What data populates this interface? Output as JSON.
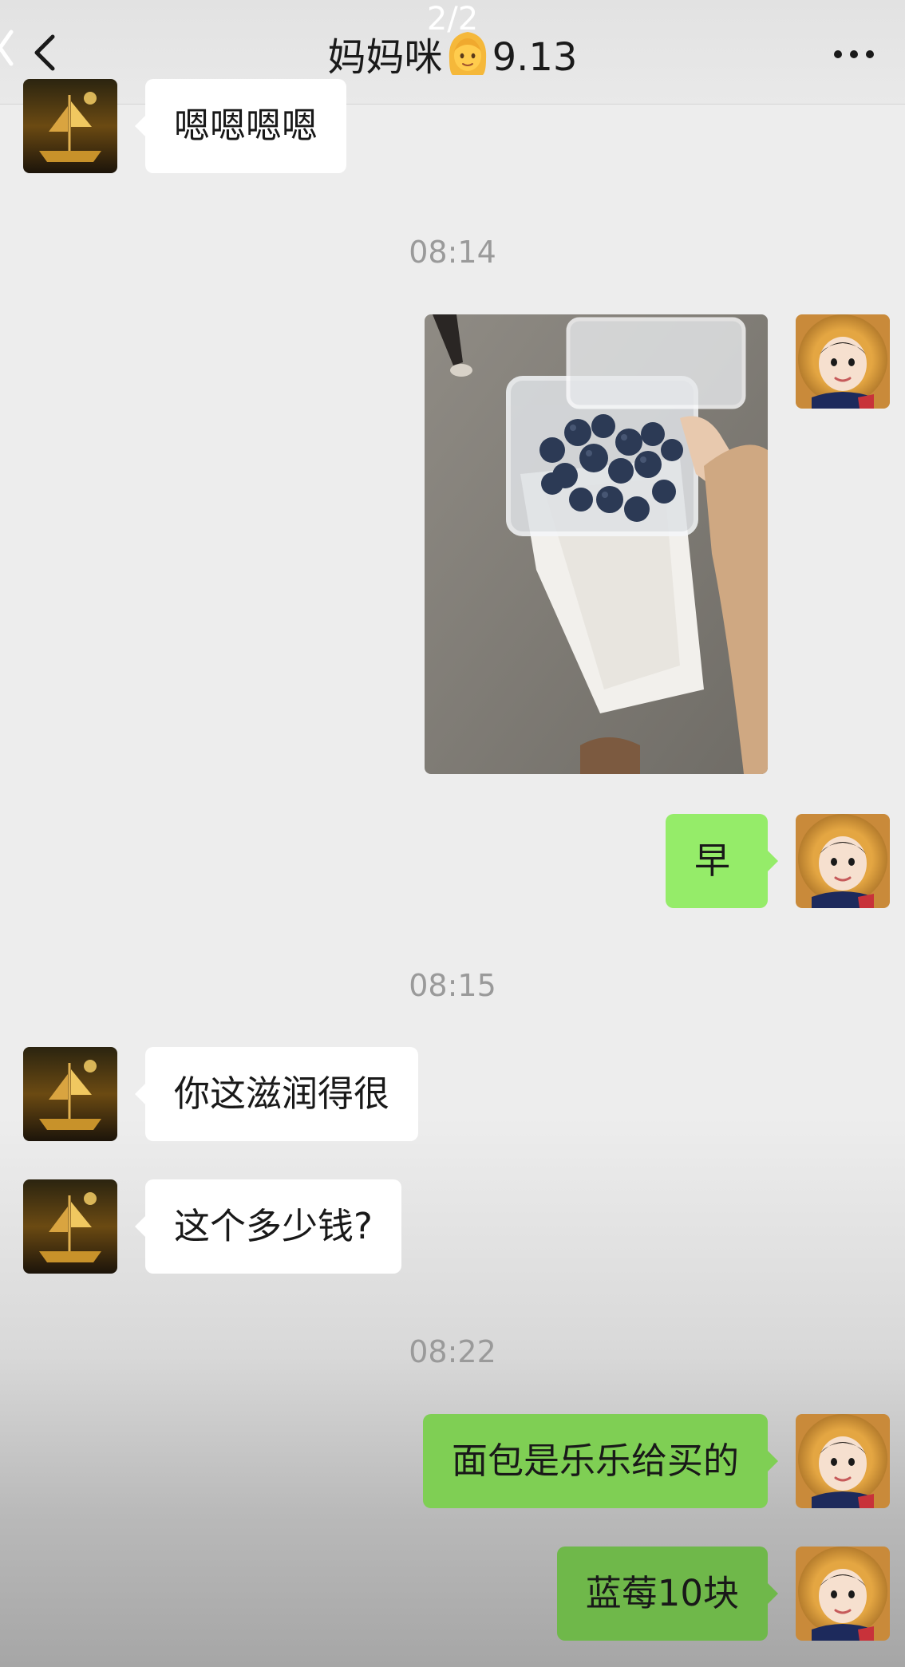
{
  "header": {
    "page_indicator": "2/2",
    "title_prefix": "妈妈咪",
    "title_emoji": "woman-emoji",
    "title_suffix": "9.13",
    "back_icon": "chevron-left-icon",
    "more_icon": "ellipsis-icon"
  },
  "messages": [
    {
      "side": "in",
      "text": "嗯嗯嗯嗯"
    },
    {
      "timestamp": "08:14"
    },
    {
      "side": "out",
      "type": "image",
      "image_desc": "blueberries-photo"
    },
    {
      "side": "out",
      "text": "早"
    },
    {
      "timestamp": "08:15"
    },
    {
      "side": "in",
      "text": "你这滋润得很"
    },
    {
      "side": "in",
      "text": "这个多少钱?"
    },
    {
      "timestamp": "08:22"
    },
    {
      "side": "out",
      "text": "面包是乐乐给买的"
    },
    {
      "side": "out",
      "text": "蓝莓10块"
    }
  ],
  "colors": {
    "background": "#ededed",
    "incoming_bubble": "#ffffff",
    "outgoing_bubble": "#95ec69",
    "timestamp_text": "#9a9a9a"
  }
}
